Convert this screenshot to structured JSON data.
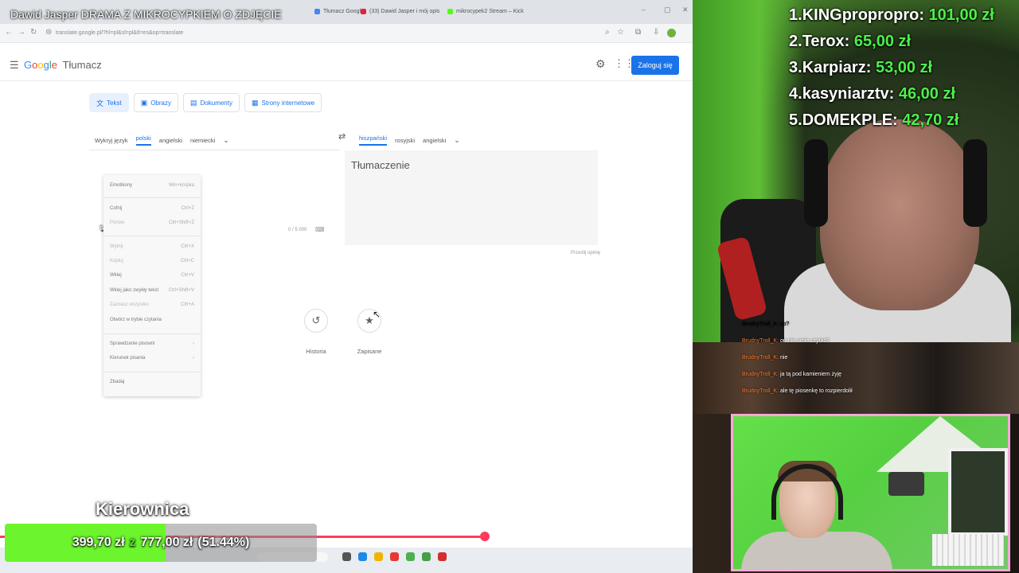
{
  "video_title": "Dawid Jasper DRAMA Z MIKROCYPKIEM O ZDJĘCIE",
  "browser": {
    "tabs": [
      "Tłumacz Google",
      "(33) Dawid Jasper i mój opis",
      "mikrocypek2 Stream – Kick"
    ],
    "tab_colors": [
      "#4285f4",
      "#e2233b",
      "#53fc18"
    ],
    "url": "translate.google.pl/?hl=pl&sl=pl&tl=es&op=translate"
  },
  "translate": {
    "logo_google": [
      "G",
      "o",
      "o",
      "g",
      "l",
      "e"
    ],
    "product": "Tłumacz",
    "signin_label": "Zaloguj się",
    "modes": [
      {
        "label": "Tekst",
        "icon": "translate-icon"
      },
      {
        "label": "Obrazy",
        "icon": "image-icon"
      },
      {
        "label": "Dokumenty",
        "icon": "document-icon"
      },
      {
        "label": "Strony internetowe",
        "icon": "web-icon"
      }
    ],
    "source_langs": [
      "Wykryj język",
      "polski",
      "angielski",
      "niemiecki"
    ],
    "target_langs": [
      "hiszpański",
      "rosyjski",
      "angielski"
    ],
    "counter": "0 / 5 000",
    "target_placeholder": "Tłumaczenie",
    "feedback_label": "Prześlij opinię",
    "history_label": "Historia",
    "saved_label": "Zapisane"
  },
  "context_menu": {
    "items": [
      {
        "label": "Emotikony",
        "shortcut": "Win+kropka",
        "dim": false
      },
      {
        "label": "Cofnij",
        "shortcut": "Ctrl+Z",
        "dim": false
      },
      {
        "label": "Ponów",
        "shortcut": "Ctrl+Shift+Z",
        "dim": true
      },
      {
        "label": "Wytnij",
        "shortcut": "Ctrl+X",
        "dim": true
      },
      {
        "label": "Kopiuj",
        "shortcut": "Ctrl+C",
        "dim": true
      },
      {
        "label": "Wklej",
        "shortcut": "Ctrl+V",
        "dim": false
      },
      {
        "label": "Wklej jako zwykły tekst",
        "shortcut": "Ctrl+Shift+V",
        "dim": false
      },
      {
        "label": "Zaznacz wszystko",
        "shortcut": "Ctrl+A",
        "dim": true
      },
      {
        "label": "Otwórz w trybie czytania",
        "shortcut": "",
        "dim": false
      },
      {
        "label": "Sprawdzanie pisowni",
        "shortcut": "›",
        "dim": false
      },
      {
        "label": "Kierunek pisania",
        "shortcut": "›",
        "dim": false
      },
      {
        "label": "Zbadaj",
        "shortcut": "",
        "dim": false
      }
    ]
  },
  "goal": {
    "name": "Kierownica",
    "current": "399,70 zł",
    "separator": "z",
    "target": "777,00 zł",
    "percent_label": "(51.44%)",
    "fraction": 0.5144
  },
  "video_progress": 0.7,
  "leaderboard": [
    {
      "rank": "1.",
      "name": "KINGpropropro:",
      "amount": "101,00 zł"
    },
    {
      "rank": "2.",
      "name": "Terox:",
      "amount": "65,00 zł"
    },
    {
      "rank": "3.",
      "name": "Karpiarz:",
      "amount": "53,00 zł"
    },
    {
      "rank": "4.",
      "name": "kasyniarztv:",
      "amount": "46,00 zł"
    },
    {
      "rank": "5.",
      "name": "DOMEKPLE:",
      "amount": "42,70 zł"
    }
  ],
  "chat": [
    {
      "user": "BrudnyTroll_K:",
      "msg": "co?"
    },
    {
      "user": "BrudnyTroll_K:",
      "msg": "on nie umie czytać?"
    },
    {
      "user": "BrudnyTroll_K:",
      "msg": "nie"
    },
    {
      "user": "BrudnyTroll_K:",
      "msg": "ja tą pod kamieniem żyję"
    },
    {
      "user": "BrudnyTroll_K:",
      "msg": "ale tę piosenkę to rozpierdolił"
    }
  ],
  "colors": {
    "goal_fill": "#6cf52c",
    "leaderboard_amount": "#4cf04a",
    "chat_user": "#ff7a2f",
    "progress": "#ff3b5c",
    "google_blue": "#1a73e8"
  }
}
